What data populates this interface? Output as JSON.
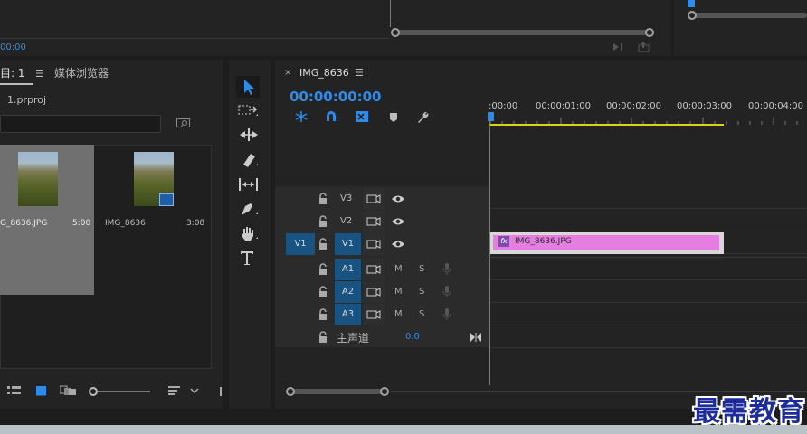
{
  "top": {
    "timecode": "00:00"
  },
  "project": {
    "tab_label": "目: 1",
    "tab_media_browser": "媒体浏览器",
    "file_name": "1.prproj",
    "items": [
      {
        "name": "G_8636.JPG",
        "duration": "5:00"
      },
      {
        "name": "IMG_8636",
        "duration": "3:08"
      }
    ]
  },
  "tools": [
    "selection-tool",
    "track-select-tool",
    "ripple-edit-tool",
    "razor-tool",
    "slip-tool",
    "pen-tool",
    "hand-tool",
    "type-tool"
  ],
  "sequence": {
    "tab_title": "IMG_8636",
    "timecode": "00:00:00:00",
    "ruler": [
      ":00:00",
      "00:00:01:00",
      "00:00:02:00",
      "00:00:03:00",
      "00:00:04:00"
    ],
    "video_tracks": [
      {
        "name": "V3",
        "source": ""
      },
      {
        "name": "V2",
        "source": ""
      },
      {
        "name": "V1",
        "source": "V1"
      }
    ],
    "audio_tracks": [
      {
        "name": "A1",
        "m": "M",
        "s": "S"
      },
      {
        "name": "A2",
        "m": "M",
        "s": "S"
      },
      {
        "name": "A3",
        "m": "M",
        "s": "S"
      }
    ],
    "master": {
      "label": "主声道",
      "value": "0.0"
    },
    "clip": {
      "fx": "fx",
      "name": "IMG_8636.JPG",
      "color": "#e57ee0"
    }
  },
  "watermark": "最需教育",
  "colors": {
    "accent": "#2d8ceb",
    "clip": "#e57ee0",
    "work_area": "#d8d220"
  }
}
